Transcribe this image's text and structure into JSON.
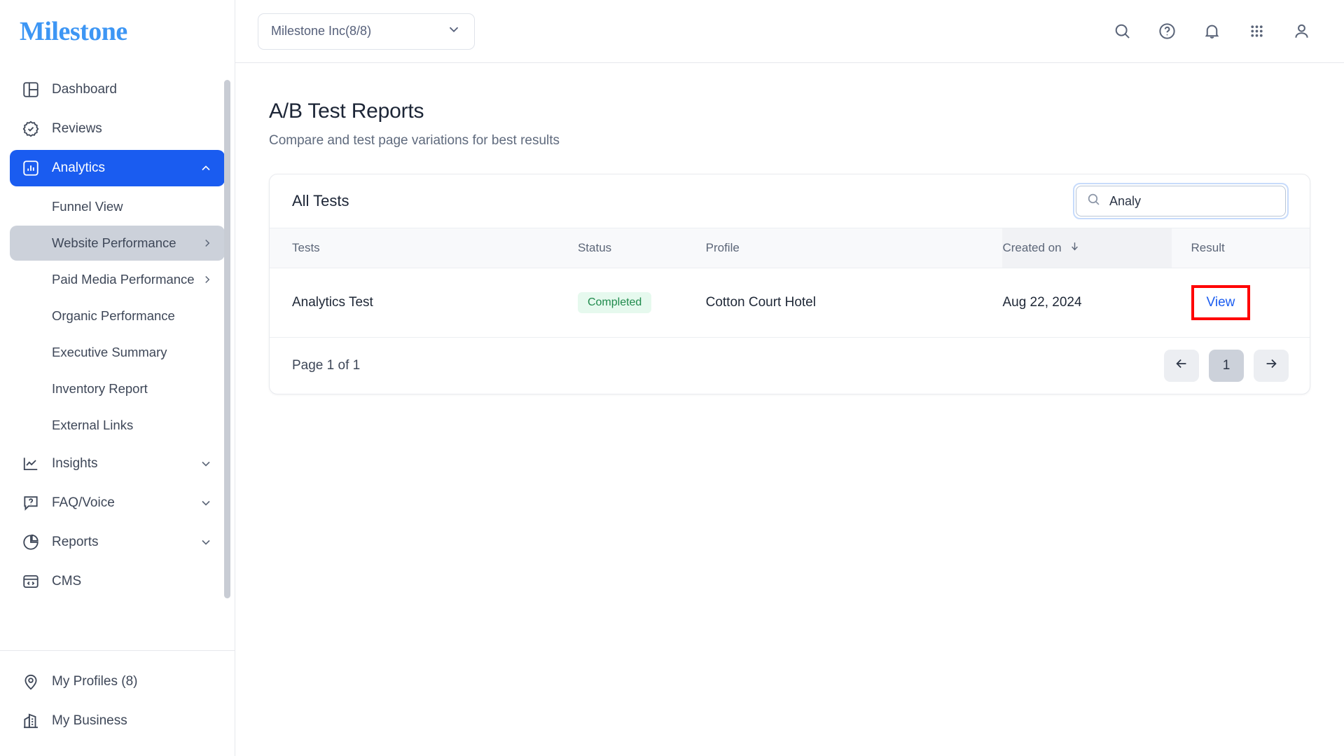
{
  "brand": {
    "logo_text": "Milestone",
    "logo_color": "#3d96f4"
  },
  "sidebar": {
    "items": [
      {
        "label": "Dashboard",
        "icon": "dashboard-icon",
        "type": "item"
      },
      {
        "label": "Reviews",
        "icon": "verified-badge-icon",
        "type": "item"
      },
      {
        "label": "Analytics",
        "icon": "bar-chart-icon",
        "type": "item",
        "active": true,
        "chevron": "chevron-up-icon"
      },
      {
        "label": "Funnel View",
        "type": "sub"
      },
      {
        "label": "Website Performance",
        "type": "sub",
        "selected": true,
        "chevron": "chevron-right-icon"
      },
      {
        "label": "Paid Media Performance",
        "type": "sub",
        "chevron": "chevron-right-icon"
      },
      {
        "label": "Organic Performance",
        "type": "sub"
      },
      {
        "label": "Executive Summary",
        "type": "sub"
      },
      {
        "label": "Inventory Report",
        "type": "sub"
      },
      {
        "label": "External Links",
        "type": "sub"
      },
      {
        "label": "Insights",
        "icon": "line-chart-icon",
        "type": "item",
        "chevron": "chevron-down-icon"
      },
      {
        "label": "FAQ/Voice",
        "icon": "question-bubble-icon",
        "type": "item",
        "chevron": "chevron-down-icon"
      },
      {
        "label": "Reports",
        "icon": "pie-chart-icon",
        "type": "item",
        "chevron": "chevron-down-icon"
      },
      {
        "label": "CMS",
        "icon": "code-window-icon",
        "type": "item"
      }
    ],
    "bottom_items": [
      {
        "label": "My Profiles (8)",
        "icon": "map-pin-icon"
      },
      {
        "label": "My Business",
        "icon": "building-icon"
      }
    ]
  },
  "topbar": {
    "org_selector": {
      "value": "Milestone Inc(8/8)",
      "chevron": "chevron-down-icon"
    },
    "icons": [
      {
        "name": "search-icon"
      },
      {
        "name": "help-circle-icon"
      },
      {
        "name": "bell-icon"
      },
      {
        "name": "apps-grid-icon"
      },
      {
        "name": "user-account-icon"
      }
    ]
  },
  "page": {
    "title": "A/B Test Reports",
    "subtitle": "Compare and test page variations for best results"
  },
  "card": {
    "title": "All Tests",
    "search": {
      "value": "Analy",
      "placeholder": "Search",
      "icon": "search-icon"
    },
    "columns": [
      {
        "key": "tests",
        "label": "Tests"
      },
      {
        "key": "status",
        "label": "Status"
      },
      {
        "key": "profile",
        "label": "Profile"
      },
      {
        "key": "created",
        "label": "Created on",
        "sorted": true,
        "sort_icon": "arrow-down-icon"
      },
      {
        "key": "result",
        "label": "Result"
      }
    ],
    "rows": [
      {
        "tests": "Analytics Test",
        "status": "Completed",
        "status_color": "#1f8a4c",
        "status_bg": "#e6f9ee",
        "profile": "Cotton Court Hotel",
        "created": "Aug 22, 2024",
        "result_label": "View",
        "result_highlight_color": "#ff0000"
      }
    ],
    "pagination": {
      "info": "Page 1 of 1",
      "prev_icon": "arrow-left-icon",
      "next_icon": "arrow-right-icon",
      "current_page": "1"
    }
  }
}
